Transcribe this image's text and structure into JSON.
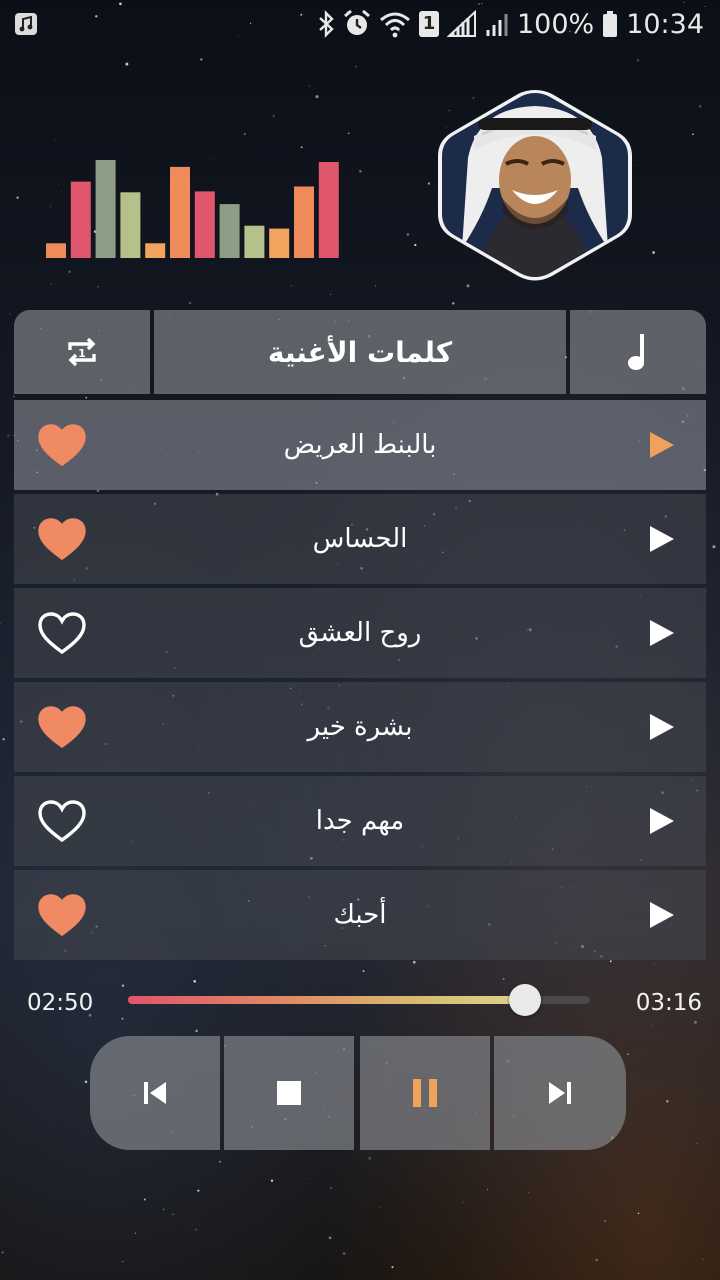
{
  "status_bar": {
    "battery_percent": "100%",
    "clock": "10:34",
    "sim_badge": "1",
    "icons": [
      "music-notification-icon",
      "bluetooth-icon",
      "alarm-icon",
      "wifi-icon",
      "sim-icon",
      "signal-icon",
      "signal-icon",
      "battery-icon"
    ]
  },
  "visualizer": {
    "levels": [
      0.15,
      0.78,
      1.0,
      0.67,
      0.15,
      0.93,
      0.68,
      0.55,
      0.33,
      0.3,
      0.73,
      0.98
    ],
    "colors": [
      "#ef8a5a",
      "#e0566c",
      "#8e9e86",
      "#b6c08a",
      "#f2a35e",
      "#ef8a5a",
      "#e0566c",
      "#8e9e86",
      "#b6c08a",
      "#f2a35e",
      "#ef8a5a",
      "#e0566c"
    ]
  },
  "tabs": {
    "repeat_icon": "repeat-one-icon",
    "lyrics_label": "كلمات الأغنية",
    "music_icon": "music-note-icon"
  },
  "songs": [
    {
      "title": "بالبنط العريض",
      "favorite": true,
      "active": true
    },
    {
      "title": "الحساس",
      "favorite": true,
      "active": false
    },
    {
      "title": "روح العشق",
      "favorite": false,
      "active": false
    },
    {
      "title": "بشرة خير",
      "favorite": true,
      "active": false
    },
    {
      "title": "مهم جدا",
      "favorite": false,
      "active": false
    },
    {
      "title": "أحبك",
      "favorite": true,
      "active": false
    }
  ],
  "player": {
    "elapsed": "02:50",
    "duration": "03:16",
    "progress": 0.86
  },
  "colors": {
    "accent": "#f0a25a",
    "heart": "#ef8a63",
    "panel": "#787a80"
  }
}
